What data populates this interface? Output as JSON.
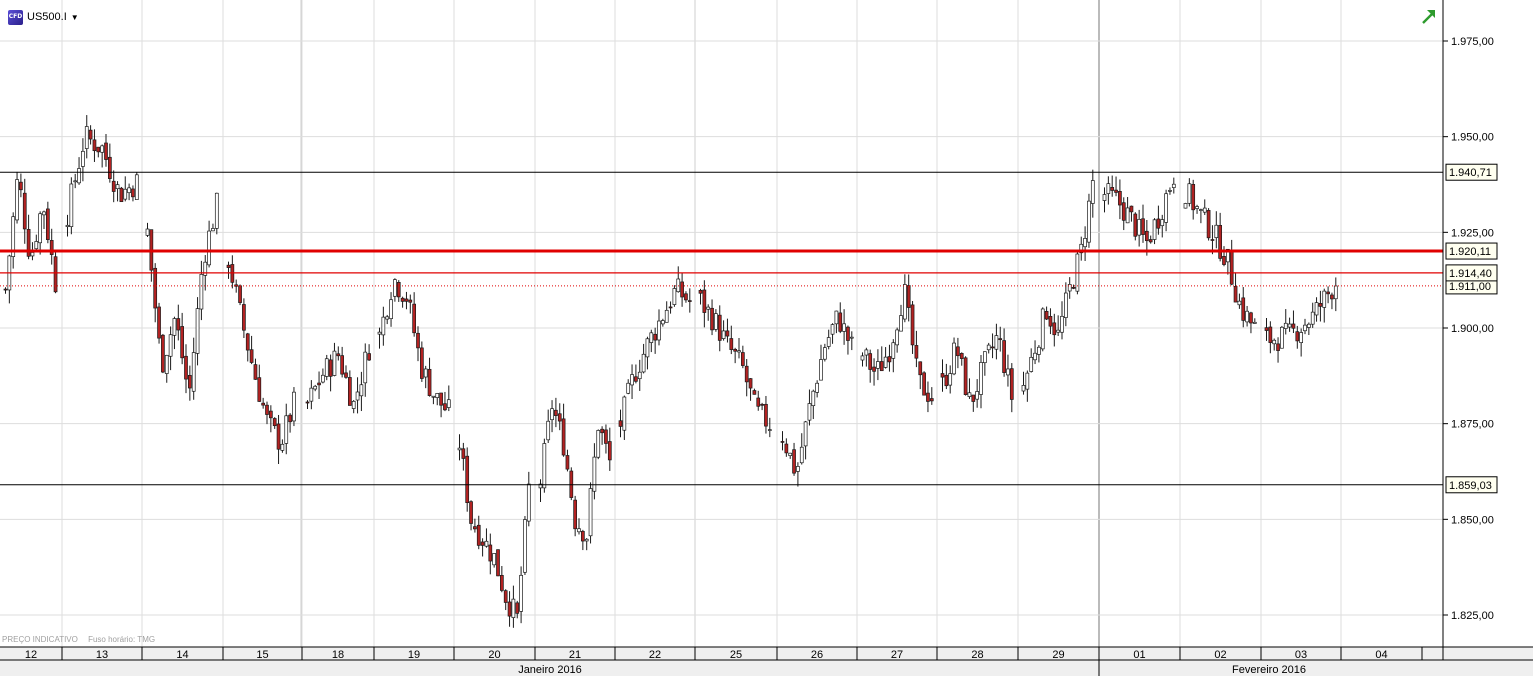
{
  "header": {
    "symbol": "US500.I",
    "instrument_icon": "cfd-icon",
    "dropdown_icon": "chevron-down-icon",
    "trend_icon": "trend-arrow-icon"
  },
  "footer": {
    "price_note": "PREÇO INDICATIVO",
    "timezone_note": "Fuso horário: TMG"
  },
  "colors": {
    "up_candle": "#ffffff",
    "down_candle": "#b22222",
    "grid": "#dddddd",
    "support_resistance": "#000000",
    "level_red": "#e00000"
  },
  "chart_data": {
    "type": "candlestick",
    "instrument": "US500.I",
    "ylim": [
      1815,
      1985
    ],
    "y_ticks": [
      "1.825,00",
      "1.850,00",
      "1.875,00",
      "1.900,00",
      "1.925,00",
      "1.950,00",
      "1.975,00"
    ],
    "y_tick_values": [
      1825,
      1850,
      1875,
      1900,
      1925,
      1950,
      1975
    ],
    "x_day_labels": [
      "12",
      "13",
      "14",
      "15",
      "18",
      "19",
      "20",
      "21",
      "22",
      "25",
      "26",
      "27",
      "28",
      "29",
      "01",
      "02",
      "03",
      "04"
    ],
    "x_month_labels": [
      "Janeiro 2016",
      "Fevereiro 2016"
    ],
    "horizontal_levels": [
      {
        "label": "1.940,71",
        "value": 1940.71,
        "style": "black"
      },
      {
        "label": "1.920,11",
        "value": 1920.11,
        "style": "red-thick"
      },
      {
        "label": "1.914,40",
        "value": 1914.4,
        "style": "red-thin"
      },
      {
        "label": "1.911,00",
        "value": 1911.0,
        "style": "red-dotted"
      },
      {
        "label": "1.859,03",
        "value": 1859.03,
        "style": "black"
      }
    ],
    "price_path": [
      {
        "day": "12",
        "values": [
          1910,
          1940,
          1918,
          1933,
          1912
        ]
      },
      {
        "day": "13",
        "values": [
          1930,
          1950,
          1947,
          1935,
          1938
        ]
      },
      {
        "day": "14",
        "values": [
          1925,
          1890,
          1903,
          1882,
          1918,
          1932
        ]
      },
      {
        "day": "15",
        "values": [
          1918,
          1902,
          1888,
          1875,
          1870,
          1880
        ]
      },
      {
        "day": "18",
        "values": [
          1880,
          1888,
          1893,
          1880,
          1895
        ]
      },
      {
        "day": "19",
        "values": [
          1898,
          1913,
          1908,
          1890,
          1882,
          1878
        ]
      },
      {
        "day": "20",
        "values": [
          1870,
          1850,
          1845,
          1840,
          1830,
          1824,
          1858
        ]
      },
      {
        "day": "21",
        "values": [
          1860,
          1880,
          1870,
          1850,
          1846,
          1875,
          1865
        ]
      },
      {
        "day": "22",
        "values": [
          1875,
          1888,
          1896,
          1903,
          1910,
          1907
        ]
      },
      {
        "day": "25",
        "values": [
          1907,
          1902,
          1895,
          1890,
          1878,
          1875
        ]
      },
      {
        "day": "26",
        "values": [
          1872,
          1862,
          1880,
          1895,
          1903,
          1895
        ]
      },
      {
        "day": "27",
        "values": [
          1893,
          1888,
          1895,
          1910,
          1886,
          1882
        ]
      },
      {
        "day": "28",
        "values": [
          1885,
          1895,
          1880,
          1890,
          1898,
          1882
        ]
      },
      {
        "day": "29",
        "values": [
          1885,
          1895,
          1905,
          1898,
          1910,
          1920,
          1938
        ]
      },
      {
        "day": "01",
        "values": [
          1935,
          1933,
          1928,
          1922,
          1930,
          1940
        ]
      },
      {
        "day": "02",
        "values": [
          1936,
          1930,
          1925,
          1918,
          1905,
          1900
        ]
      },
      {
        "day": "03",
        "values": [
          1897,
          1898,
          1903,
          1912
        ]
      }
    ]
  }
}
